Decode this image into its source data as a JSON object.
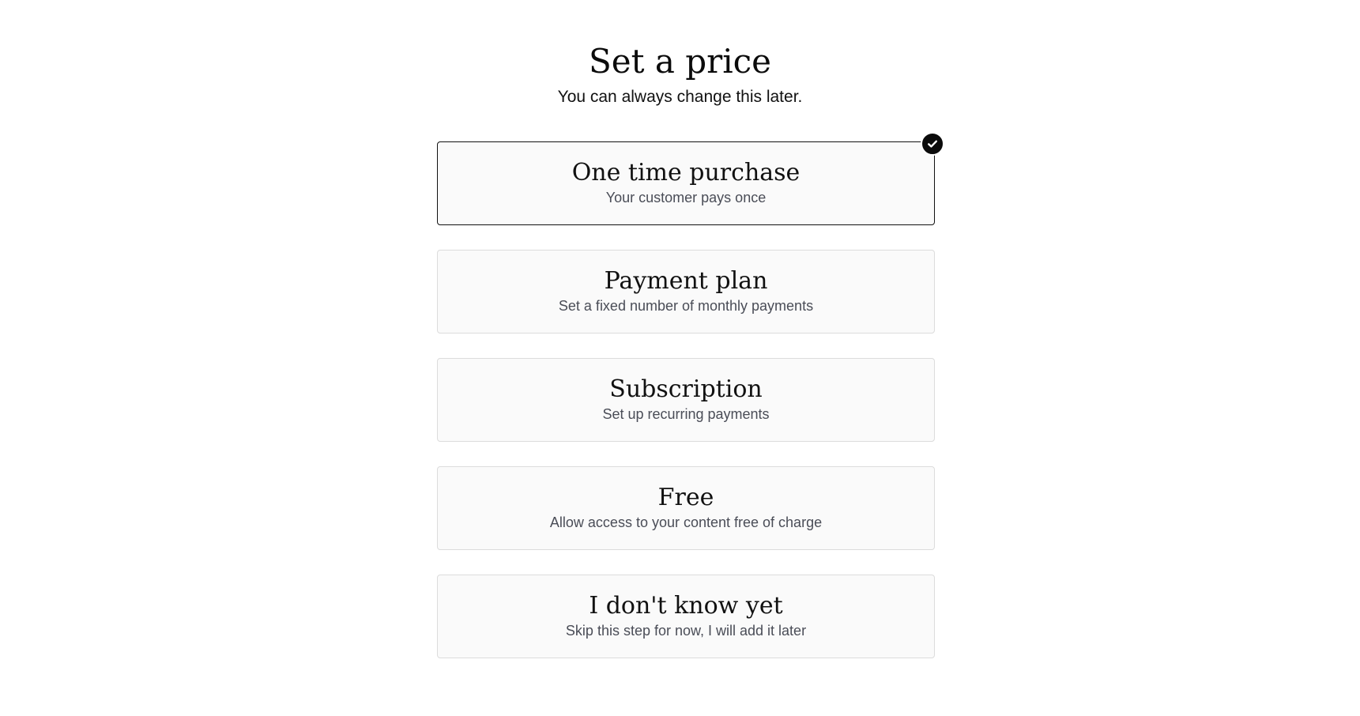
{
  "header": {
    "title": "Set a price",
    "subtitle": "You can always change this later."
  },
  "options": [
    {
      "title": "One time purchase",
      "description": "Your customer pays once",
      "selected": true
    },
    {
      "title": "Payment plan",
      "description": "Set a fixed number of monthly payments",
      "selected": false
    },
    {
      "title": "Subscription",
      "description": "Set up recurring payments",
      "selected": false
    },
    {
      "title": "Free",
      "description": "Allow access to your content free of charge",
      "selected": false
    },
    {
      "title": "I don't know yet",
      "description": "Skip this step for now, I will add it later",
      "selected": false
    }
  ],
  "icons": {
    "selected_indicator": "check-circle-icon"
  },
  "colors": {
    "selected_border": "#111111",
    "card_background": "#fafafa",
    "card_border": "#dcdcdc",
    "check_badge": "#0b0b0b"
  }
}
